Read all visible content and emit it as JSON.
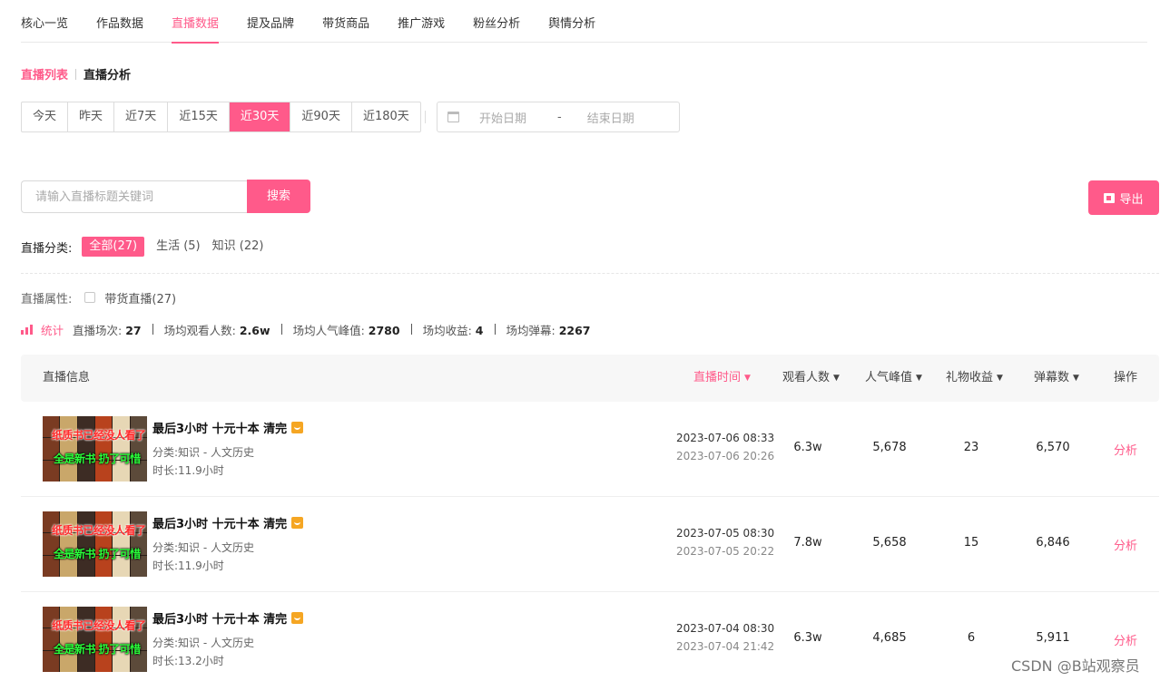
{
  "top_tabs": [
    "核心一览",
    "作品数据",
    "直播数据",
    "提及品牌",
    "带货商品",
    "推广游戏",
    "粉丝分析",
    "舆情分析"
  ],
  "active_top_tab": "直播数据",
  "sub_tabs": [
    "直播列表",
    "直播分析"
  ],
  "active_sub_tab": "直播列表",
  "ranges": [
    "今天",
    "昨天",
    "近7天",
    "近15天",
    "近30天",
    "近90天",
    "近180天"
  ],
  "active_range": "近30天",
  "date_range": {
    "start_placeholder": "开始日期",
    "separator": "-",
    "end_placeholder": "结束日期"
  },
  "search": {
    "placeholder": "请输入直播标题关键词",
    "button": "搜索"
  },
  "export_label": "导出",
  "category": {
    "label": "直播分类:",
    "items": [
      "全部(27)",
      "生活 (5)",
      "知识 (22)"
    ],
    "active": "全部(27)"
  },
  "attribute": {
    "label": "直播属性:",
    "option": "带货直播(27)",
    "checked": false
  },
  "stats": {
    "title": "统计",
    "items": [
      {
        "label": "直播场次:",
        "value": "27"
      },
      {
        "label": "场均观看人数:",
        "value": "2.6w"
      },
      {
        "label": "场均人气峰值:",
        "value": "2780"
      },
      {
        "label": "场均收益:",
        "value": "4"
      },
      {
        "label": "场均弹幕:",
        "value": "2267"
      }
    ]
  },
  "table": {
    "headers": {
      "info": "直播信息",
      "time": "直播时间",
      "viewers": "观看人数",
      "peak": "人气峰值",
      "gift": "礼物收益",
      "danmaku": "弹幕数",
      "action": "操作"
    },
    "sorted_column": "直播时间",
    "rows": [
      {
        "thumb_line1": "纸质书已经没人看了",
        "thumb_line2": "全是新书 扔了可惜",
        "title": "最后3小时 十元十本 清完",
        "category": "分类:知识 - 人文历史",
        "duration": "时长:11.9小时",
        "start": "2023-07-06 08:33",
        "end": "2023-07-06 20:26",
        "viewers": "6.3w",
        "peak": "5,678",
        "gift": "23",
        "danmaku": "6,570",
        "action": "分析"
      },
      {
        "thumb_line1": "纸质书已经没人看了",
        "thumb_line2": "全是新书 扔了可惜",
        "title": "最后3小时 十元十本 清完",
        "category": "分类:知识 - 人文历史",
        "duration": "时长:11.9小时",
        "start": "2023-07-05 08:30",
        "end": "2023-07-05 20:22",
        "viewers": "7.8w",
        "peak": "5,658",
        "gift": "15",
        "danmaku": "6,846",
        "action": "分析"
      },
      {
        "thumb_line1": "纸质书已经没人看了",
        "thumb_line2": "全是新书 扔了可惜",
        "title": "最后3小时 十元十本 清完",
        "category": "分类:知识 - 人文历史",
        "duration": "时长:13.2小时",
        "start": "2023-07-04 08:30",
        "end": "2023-07-04 21:42",
        "viewers": "6.3w",
        "peak": "4,685",
        "gift": "6",
        "danmaku": "5,911",
        "action": "分析"
      }
    ]
  },
  "watermark": "CSDN @B站观察员",
  "colors": {
    "accent": "#ff5a8a",
    "text": "#333333",
    "muted": "#888888",
    "header_bg": "#f7f7f7"
  }
}
